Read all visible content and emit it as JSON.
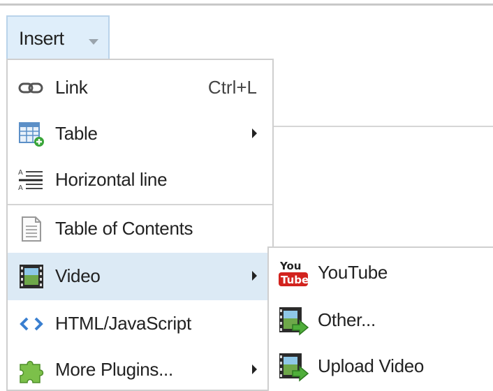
{
  "toolbar": {
    "insert_label": "Insert"
  },
  "menu": {
    "items": [
      {
        "label": "Link",
        "shortcut": "Ctrl+L",
        "icon": "link-icon"
      },
      {
        "label": "Table",
        "icon": "table-icon",
        "has_submenu": true
      },
      {
        "label": "Horizontal line",
        "icon": "horizontal-line-icon"
      },
      {
        "label": "Table of Contents",
        "icon": "document-icon"
      },
      {
        "label": "Video",
        "icon": "film-icon",
        "has_submenu": true,
        "highlighted": true
      },
      {
        "label": "HTML/JavaScript",
        "icon": "code-icon"
      },
      {
        "label": "More Plugins...",
        "icon": "puzzle-icon",
        "has_submenu": true
      }
    ]
  },
  "submenu": {
    "items": [
      {
        "label": "YouTube",
        "icon": "youtube-icon"
      },
      {
        "label": "Other...",
        "icon": "video-arrow-icon"
      },
      {
        "label": "Upload Video",
        "icon": "video-upload-icon"
      }
    ]
  },
  "colors": {
    "highlight": "#dceaf5",
    "button_bg": "#dfeefa",
    "border": "#cfcfcf"
  }
}
